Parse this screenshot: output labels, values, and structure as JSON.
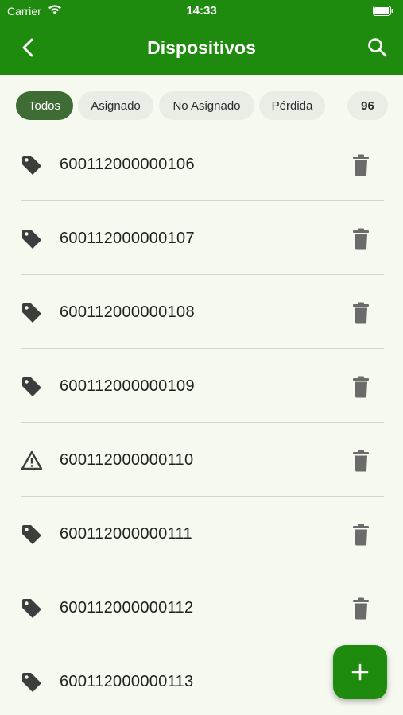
{
  "status_bar": {
    "carrier": "Carrier",
    "time": "14:33"
  },
  "app_bar": {
    "title": "Dispositivos"
  },
  "filters": {
    "chips": [
      {
        "label": "Todos",
        "active": true
      },
      {
        "label": "Asignado",
        "active": false
      },
      {
        "label": "No Asignado",
        "active": false
      },
      {
        "label": "Pérdida",
        "active": false
      }
    ],
    "count": "96"
  },
  "devices": [
    {
      "code": "600112000000106",
      "icon": "tag-icon"
    },
    {
      "code": "600112000000107",
      "icon": "tag-icon"
    },
    {
      "code": "600112000000108",
      "icon": "tag-icon"
    },
    {
      "code": "600112000000109",
      "icon": "tag-icon"
    },
    {
      "code": "600112000000110",
      "icon": "warning-icon"
    },
    {
      "code": "600112000000111",
      "icon": "tag-icon"
    },
    {
      "code": "600112000000112",
      "icon": "tag-icon"
    },
    {
      "code": "600112000000113",
      "icon": "tag-icon"
    }
  ],
  "colors": {
    "primary": "#1e8a0e",
    "chip_active": "#3f6b35",
    "background": "#f5f9ef"
  }
}
